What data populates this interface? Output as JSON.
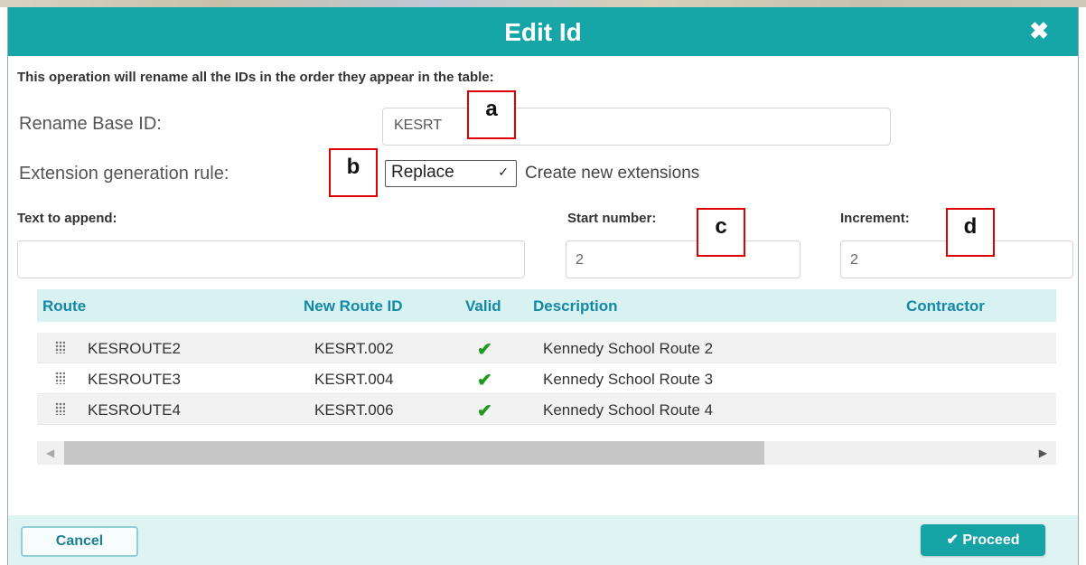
{
  "dialog": {
    "title": "Edit Id",
    "close_icon": "close-icon",
    "intro": "This operation will rename all the IDs in the order they appear in the table:"
  },
  "form": {
    "rename_base_label": "Rename Base ID:",
    "rename_base_value": "KESRT",
    "extension_rule_label": "Extension generation rule:",
    "extension_rule_value": "Replace",
    "extension_rule_desc": "Create new extensions",
    "text_append_label": "Text to append:",
    "text_append_value": "",
    "start_number_label": "Start number:",
    "start_number_value": "2",
    "increment_label": "Increment:",
    "increment_value": "2"
  },
  "callouts": [
    "a",
    "b",
    "c",
    "d"
  ],
  "table": {
    "columns": [
      "Route",
      "New Route ID",
      "Valid",
      "Description",
      "Contractor"
    ],
    "rows": [
      {
        "route": "KESROUTE2",
        "new_id": "KESRT.002",
        "valid": "✔",
        "description": "Kennedy School Route 2",
        "contractor": ""
      },
      {
        "route": "KESROUTE3",
        "new_id": "KESRT.004",
        "valid": "✔",
        "description": "Kennedy School Route 3",
        "contractor": ""
      },
      {
        "route": "KESROUTE4",
        "new_id": "KESRT.006",
        "valid": "✔",
        "description": "Kennedy School Route 4",
        "contractor": ""
      }
    ]
  },
  "footer": {
    "cancel_label": "Cancel",
    "proceed_label": "✔ Proceed"
  },
  "colors": {
    "accent": "#16a6a7",
    "header_text": "#1489a6",
    "valid": "#1e9a1e",
    "callout_border": "#e00000"
  }
}
